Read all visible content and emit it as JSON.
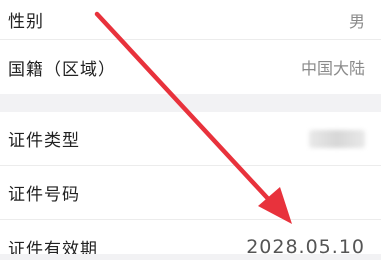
{
  "personal": {
    "gender_label": "性别",
    "gender_value": "男",
    "nationality_label": "国籍（区域）",
    "nationality_value": "中国大陆"
  },
  "id_info": {
    "type_label": "证件类型",
    "number_label": "证件号码",
    "validity_label": "证件有效期",
    "validity_value": "2028.05.10"
  },
  "annotation": {
    "arrow_color": "#e8323c"
  }
}
